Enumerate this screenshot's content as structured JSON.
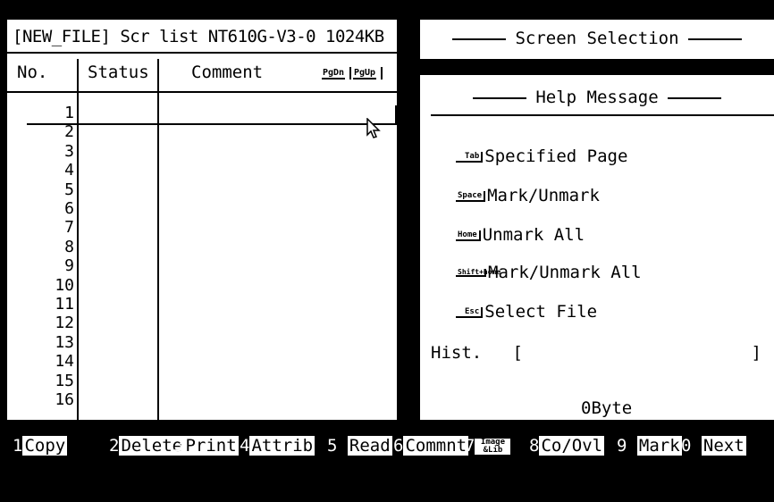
{
  "left": {
    "header": "[NEW_FILE] Scr list NT610G-V3-0 1024KB",
    "col_no": "No.",
    "col_status": "Status",
    "col_comment": "Comment",
    "pgdn": "PgDn",
    "pgup": "PgUp",
    "rows": [
      "1",
      "2",
      "3",
      "4",
      "5",
      "6",
      "7",
      "8",
      "9",
      "10",
      "11",
      "12",
      "13",
      "14",
      "15",
      "16"
    ]
  },
  "screen_selection": {
    "title": "Screen Selection"
  },
  "help": {
    "title": "Help Message",
    "items": [
      {
        "key": "Tab",
        "text": "Specified Page"
      },
      {
        "key": "Space",
        "text": "Mark/Unmark"
      },
      {
        "key": "Home",
        "text": "Unmark All"
      },
      {
        "key": "Shift+home",
        "text": "Mark/Unmark All"
      },
      {
        "key": "Esc",
        "text": "Select File"
      }
    ],
    "hist_label": "Hist.",
    "hist_open": "[",
    "hist_close": "]",
    "bytes": "0Byte"
  },
  "fkeys": [
    {
      "num": "1",
      "label": "Copy"
    },
    {
      "num": "2",
      "label": "Delete"
    },
    {
      "num": "3",
      "label": "Print"
    },
    {
      "num": "4",
      "label": "Attrib"
    },
    {
      "num": "5",
      "label": "Read"
    },
    {
      "num": "6",
      "label": "Commnt"
    },
    {
      "num": "7",
      "label": "Image &Lib"
    },
    {
      "num": "8",
      "label": "Co/Ovl"
    },
    {
      "num": "9",
      "label": "Mark"
    },
    {
      "num": "0",
      "label": "Next"
    }
  ],
  "icons": {
    "cursor": "mouse-pointer-icon"
  }
}
